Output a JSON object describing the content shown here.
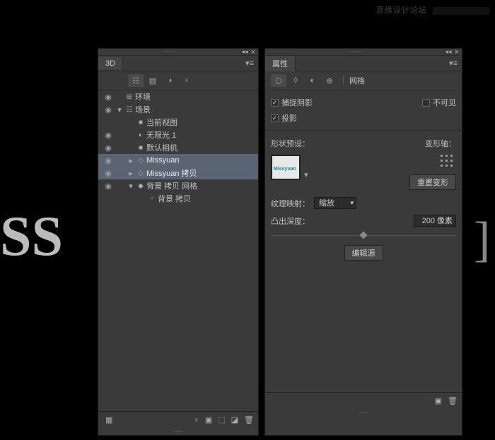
{
  "watermark": {
    "text": "思缘设计论坛"
  },
  "ss_art": "SS",
  "panel_3d": {
    "tab": "3D",
    "tree": [
      {
        "eye": true,
        "depth": 0,
        "disclosure": "",
        "icon": "env",
        "label": "环境",
        "selected": false
      },
      {
        "eye": true,
        "depth": 0,
        "disclosure": "▾",
        "icon": "scene",
        "label": "场景",
        "selected": false
      },
      {
        "eye": false,
        "depth": 1,
        "disclosure": "",
        "icon": "cam",
        "label": "当前视图",
        "selected": false
      },
      {
        "eye": true,
        "depth": 1,
        "disclosure": "",
        "icon": "light",
        "label": "无限光 1",
        "selected": false
      },
      {
        "eye": true,
        "depth": 1,
        "disclosure": "",
        "icon": "cam",
        "label": "默认相机",
        "selected": false
      },
      {
        "eye": true,
        "depth": 1,
        "disclosure": "▸",
        "icon": "mesh",
        "label": "Missyuan",
        "selected": true
      },
      {
        "eye": true,
        "depth": 1,
        "disclosure": "▸",
        "icon": "mesh",
        "label": "Missyuan 拷贝",
        "selected": true
      },
      {
        "eye": true,
        "depth": 1,
        "disclosure": "▾",
        "icon": "mesh-solid",
        "label": "背景 拷贝 网格",
        "selected": false
      },
      {
        "eye": false,
        "depth": 2,
        "disclosure": "",
        "icon": "mat",
        "label": "背景 拷贝",
        "selected": false
      }
    ]
  },
  "panel_props": {
    "tab": "属性",
    "type_label": "网格",
    "chk_shadow_catch": {
      "label": "捕捉阴影",
      "checked": true
    },
    "chk_invisible": {
      "label": "不可见",
      "checked": false
    },
    "chk_shadow_cast": {
      "label": "投影",
      "checked": true
    },
    "shape_preset_label": "形状预设：",
    "deform_axis_label": "变形轴：",
    "reset_deform_btn": "重置变形",
    "thumb_text": "Missyuan",
    "texture_map_label": "纹理映射：",
    "texture_map_value": "缩放",
    "extrude_depth_label": "凸出深度：",
    "extrude_depth_value": "200 像素",
    "edit_source_btn": "编辑源"
  }
}
